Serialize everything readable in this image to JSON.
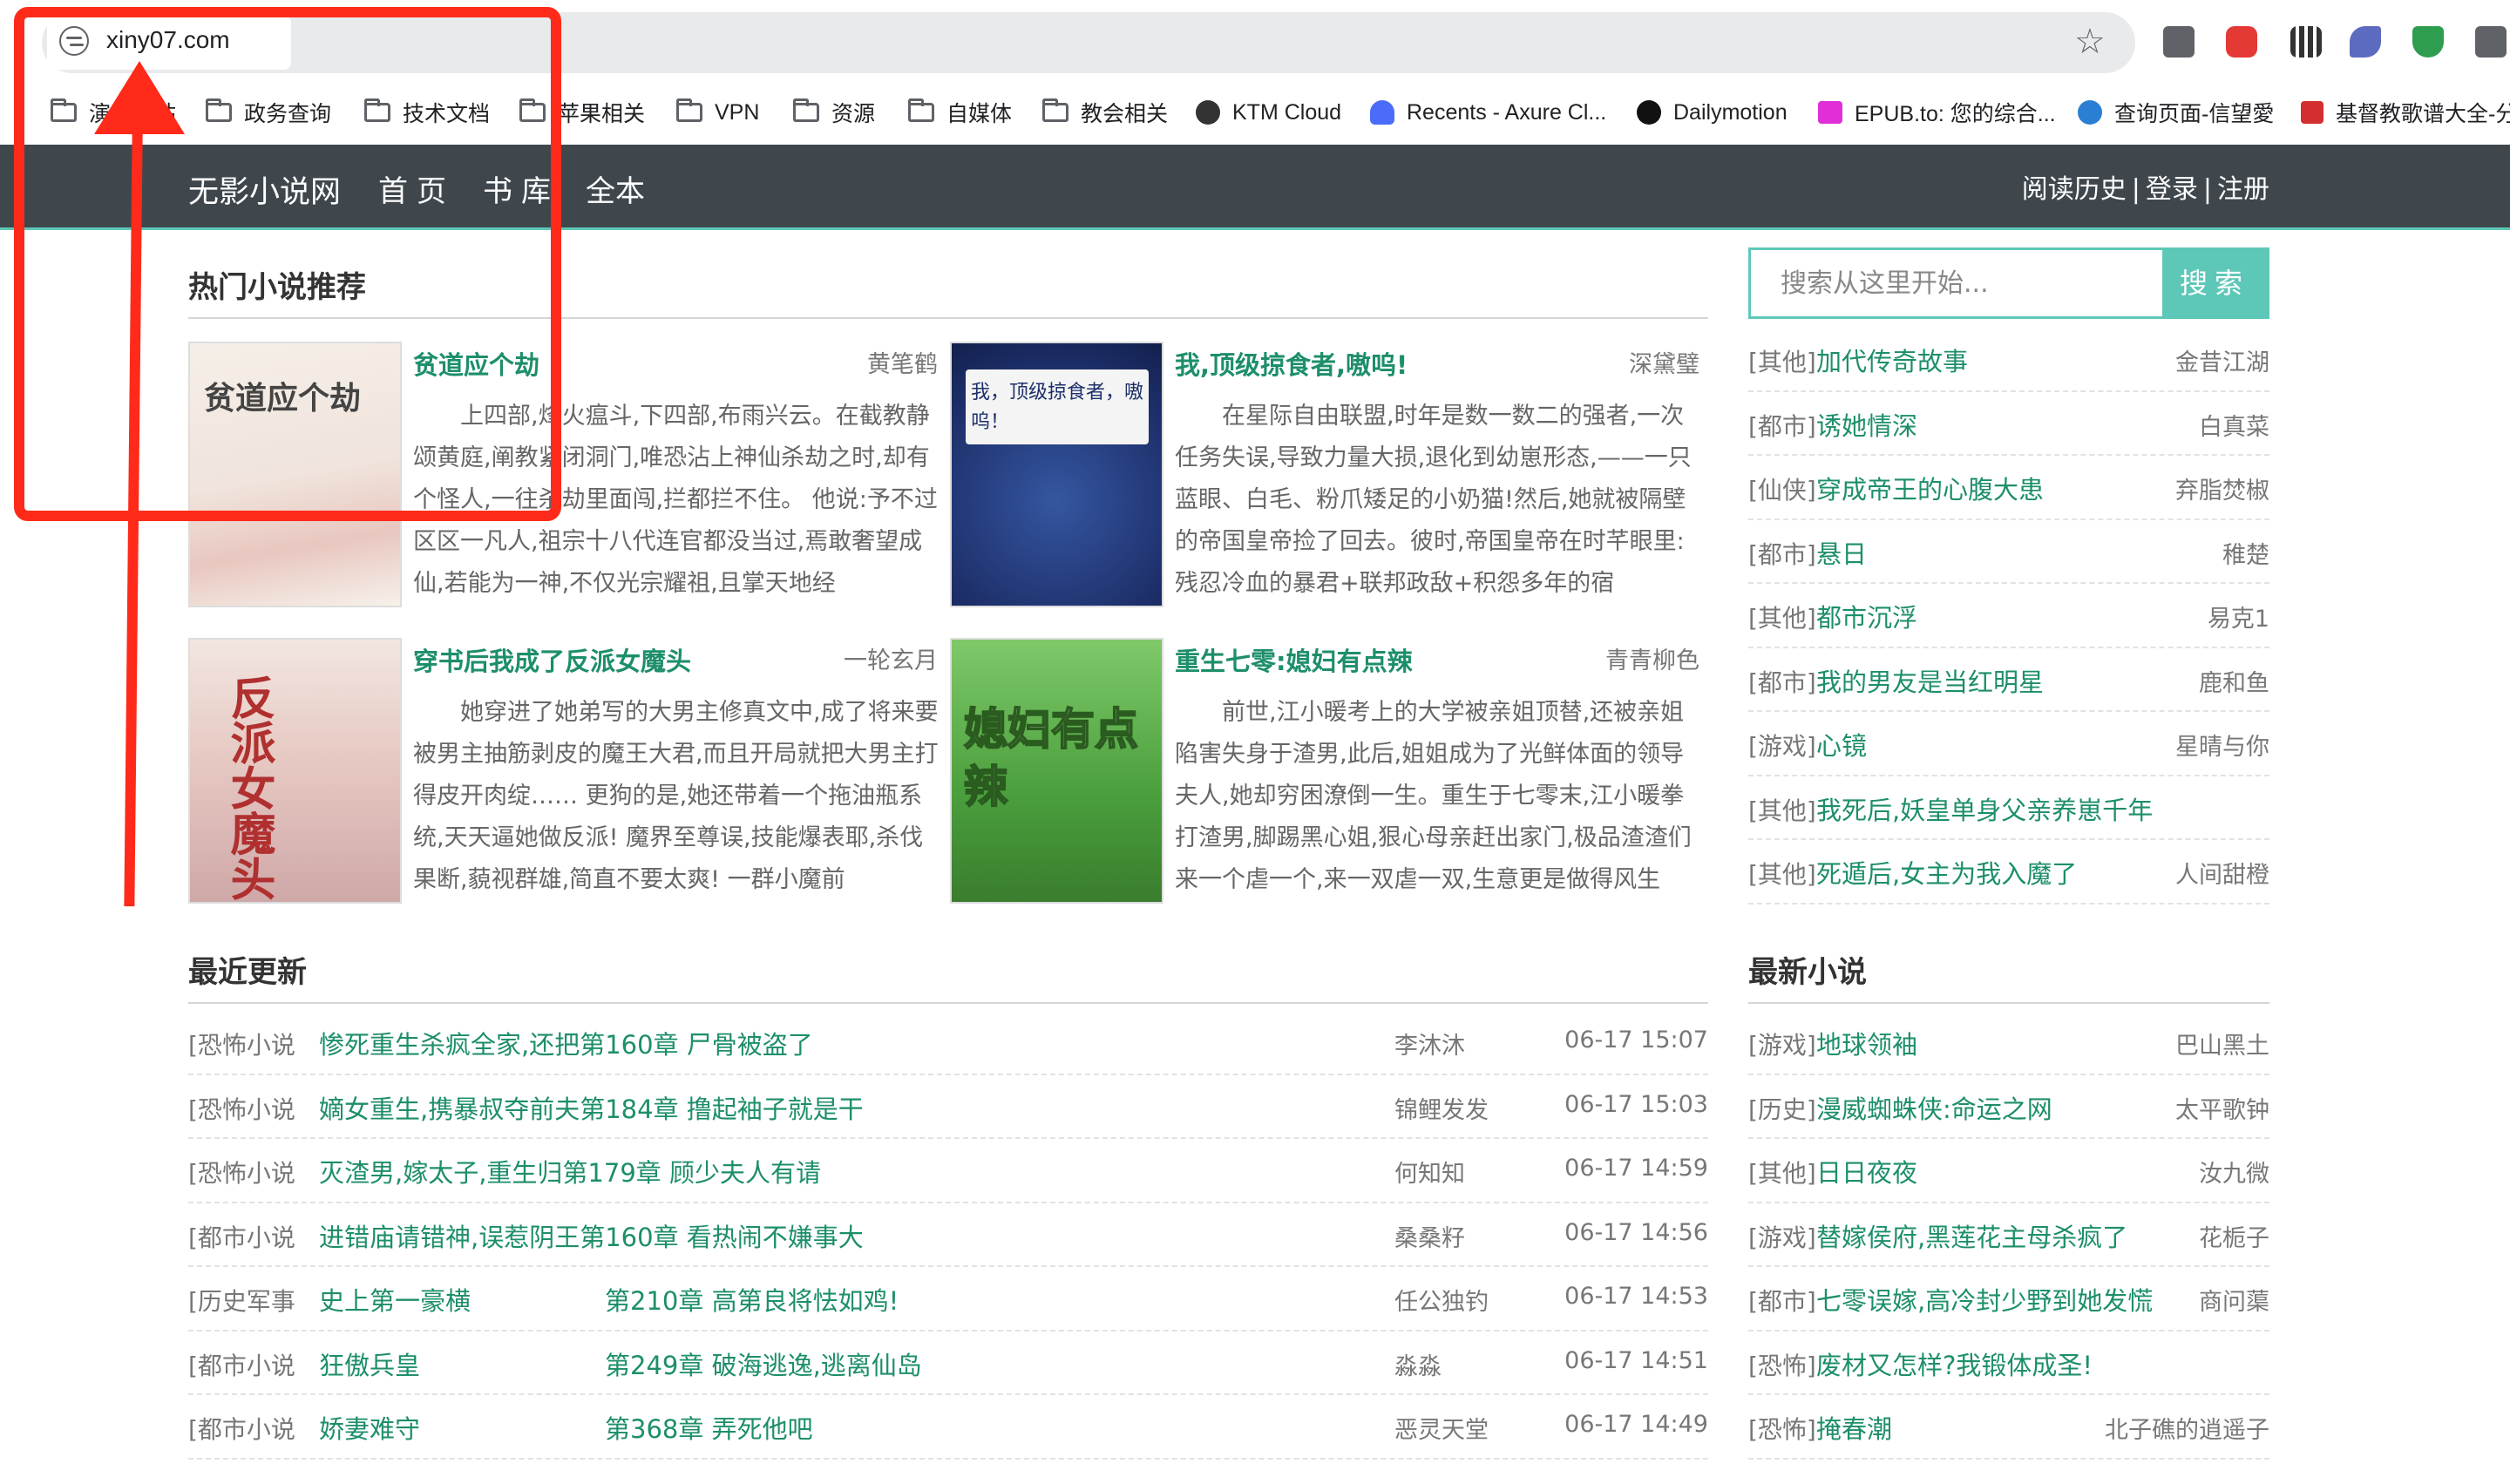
{
  "browser": {
    "url": "xiny07.com",
    "bookmarks": [
      {
        "label": "演示网站",
        "icon": "folder-icon"
      },
      {
        "label": "政务查询",
        "icon": "folder-icon"
      },
      {
        "label": "技术文档",
        "icon": "folder-icon"
      },
      {
        "label": "苹果相关",
        "icon": "folder-icon"
      },
      {
        "label": "VPN",
        "icon": "folder-icon"
      },
      {
        "label": "资源",
        "icon": "folder-icon"
      },
      {
        "label": "自媒体",
        "icon": "folder-icon"
      },
      {
        "label": "教会相关",
        "icon": "folder-icon"
      },
      {
        "label": "KTM Cloud",
        "icon": "ktm-icon"
      },
      {
        "label": "Recents - Axure Cl...",
        "icon": "axure-icon"
      },
      {
        "label": "Dailymotion",
        "icon": "dailymotion-icon"
      },
      {
        "label": "EPUB.to: 您的综合...",
        "icon": "epub-icon"
      },
      {
        "label": "查询页面-信望愛",
        "icon": "globe-icon"
      },
      {
        "label": "基督教歌谱大全-分",
        "icon": "music-icon"
      }
    ]
  },
  "nav": {
    "brand": "无影小说网",
    "home": "首页",
    "library": "书库",
    "complete": "全本",
    "history": "阅读历史",
    "login": "登录",
    "register": "注册",
    "separator": "|"
  },
  "hot": {
    "title": "热门小说推荐",
    "books": [
      {
        "title": "贫道应个劫",
        "author": "黄笔鹤",
        "desc": "上四部,烽火瘟斗,下四部,布雨兴云。在截教静颂黄庭,阐教紧闭洞门,唯恐沾上神仙杀劫之时,却有个怪人,一往杀劫里面闯,拦都拦不住。 他说:予不过区区一凡人,祖宗十八代连官都没当过,焉敢奢望成仙,若能为一神,不仅光宗耀祖,且掌天地经",
        "cover_text": "贫道应个劫"
      },
      {
        "title": "我,顶级掠食者,嗷呜!",
        "author": "深黛璧",
        "desc": "在星际自由联盟,时年是数一数二的强者,一次任务失误,导致力量大损,退化到幼崽形态,——一只蓝眼、白毛、粉爪矮足的小奶猫!然后,她就被隔壁的帝国皇帝捡了回去。彼时,帝国皇帝在时芊眼里:残忍冷血的暴君+联邦政敌+积怨多年的宿",
        "cover_text": "我，顶级掠食者，嗷呜！"
      },
      {
        "title": "穿书后我成了反派女魔头",
        "author": "一轮玄月",
        "desc": "她穿进了她弟写的大男主修真文中,成了将来要被男主抽筋剥皮的魔王大君,而且开局就把大男主打得皮开肉绽…… 更狗的是,她还带着一个拖油瓶系统,天天逼她做反派! 魔界至尊误,技能爆表耶,杀伐果断,藐视群雄,简直不要太爽! 一群小魔前",
        "cover_text": "反派女魔头"
      },
      {
        "title": "重生七零:媳妇有点辣",
        "author": "青青柳色",
        "desc": "前世,江小暖考上的大学被亲姐顶替,还被亲姐陷害失身于渣男,此后,姐姐成为了光鲜体面的领导夫人,她却穷困潦倒一生。重生于七零末,江小暖拳打渣男,脚踢黑心姐,狠心母亲赶出家门,极品渣渣们来一个虐一个,来一双虐一双,生意更是做得风生",
        "cover_text": "媳妇有点辣"
      }
    ]
  },
  "search": {
    "placeholder": "搜索从这里开始...",
    "button": "搜索"
  },
  "sidebar_top": [
    {
      "cat": "[其他]",
      "name": "加代传奇故事",
      "author": "金昔江湖"
    },
    {
      "cat": "[都市]",
      "name": "诱她情深",
      "author": "白真菜"
    },
    {
      "cat": "[仙侠]",
      "name": "穿成帝王的心腹大患",
      "author": "弃脂焚椒"
    },
    {
      "cat": "[都市]",
      "name": "悬日",
      "author": "稚楚"
    },
    {
      "cat": "[其他]",
      "name": "都市沉浮",
      "author": "易克1"
    },
    {
      "cat": "[都市]",
      "name": "我的男友是当红明星",
      "author": "鹿和鱼"
    },
    {
      "cat": "[游戏]",
      "name": "心镜",
      "author": "星晴与你"
    },
    {
      "cat": "[其他]",
      "name": "我死后,妖皇单身父亲养崽千年",
      "author": ""
    },
    {
      "cat": "[其他]",
      "name": "死遁后,女主为我入魔了",
      "author": "人间甜橙"
    }
  ],
  "recent": {
    "title": "最近更新",
    "items": [
      {
        "cat": "[恐怖小说",
        "title": "惨死重生杀疯全家,还把第160章 尸骨被盗了",
        "chapter": "",
        "author": "李沐沐",
        "time": "06-17 15:07"
      },
      {
        "cat": "[恐怖小说",
        "title": "嫡女重生,携暴叔夺前夫第184章 撸起袖子就是干",
        "chapter": "",
        "author": "锦鲤发发",
        "time": "06-17 15:03"
      },
      {
        "cat": "[恐怖小说",
        "title": "灭渣男,嫁太子,重生归第179章 顾少夫人有请",
        "chapter": "",
        "author": "何知知",
        "time": "06-17 14:59"
      },
      {
        "cat": "[都市小说",
        "title": "进错庙请错神,误惹阴王第160章 看热闹不嫌事大",
        "chapter": "",
        "author": "桑桑籽",
        "time": "06-17 14:56"
      },
      {
        "cat": "[历史军事",
        "title": "史上第一豪横",
        "chapter": "第210章 高第良将怯如鸡!",
        "author": "任公独钓",
        "time": "06-17 14:53"
      },
      {
        "cat": "[都市小说",
        "title": "狂傲兵皇",
        "chapter": "第249章 破海逃逸,逃离仙岛",
        "author": "淼淼",
        "time": "06-17 14:51"
      },
      {
        "cat": "[都市小说",
        "title": "娇妻难守",
        "chapter": "第368章 弄死他吧",
        "author": "恶灵天堂",
        "time": "06-17 14:49"
      }
    ]
  },
  "newest": {
    "title": "最新小说",
    "items": [
      {
        "cat": "[游戏]",
        "name": "地球领袖",
        "author": "巴山黑土"
      },
      {
        "cat": "[历史]",
        "name": "漫威蜘蛛侠:命运之网",
        "author": "太平歌钟"
      },
      {
        "cat": "[其他]",
        "name": "日日夜夜",
        "author": "汝九微"
      },
      {
        "cat": "[游戏]",
        "name": "替嫁侯府,黑莲花主母杀疯了",
        "author": "花栀子"
      },
      {
        "cat": "[都市]",
        "name": "七零误嫁,高冷封少野到她发慌",
        "author": "商问蕖"
      },
      {
        "cat": "[恐怖]",
        "name": "废材又怎样?我锻体成圣!",
        "author": ""
      },
      {
        "cat": "[恐怖]",
        "name": "掩春潮",
        "author": "北子礁的逍遥子"
      }
    ]
  },
  "colors": {
    "accent": "#5ec8b8",
    "link": "#1d8e6b",
    "nav_bg": "#3f474d",
    "annotation": "#ff2a1a"
  }
}
